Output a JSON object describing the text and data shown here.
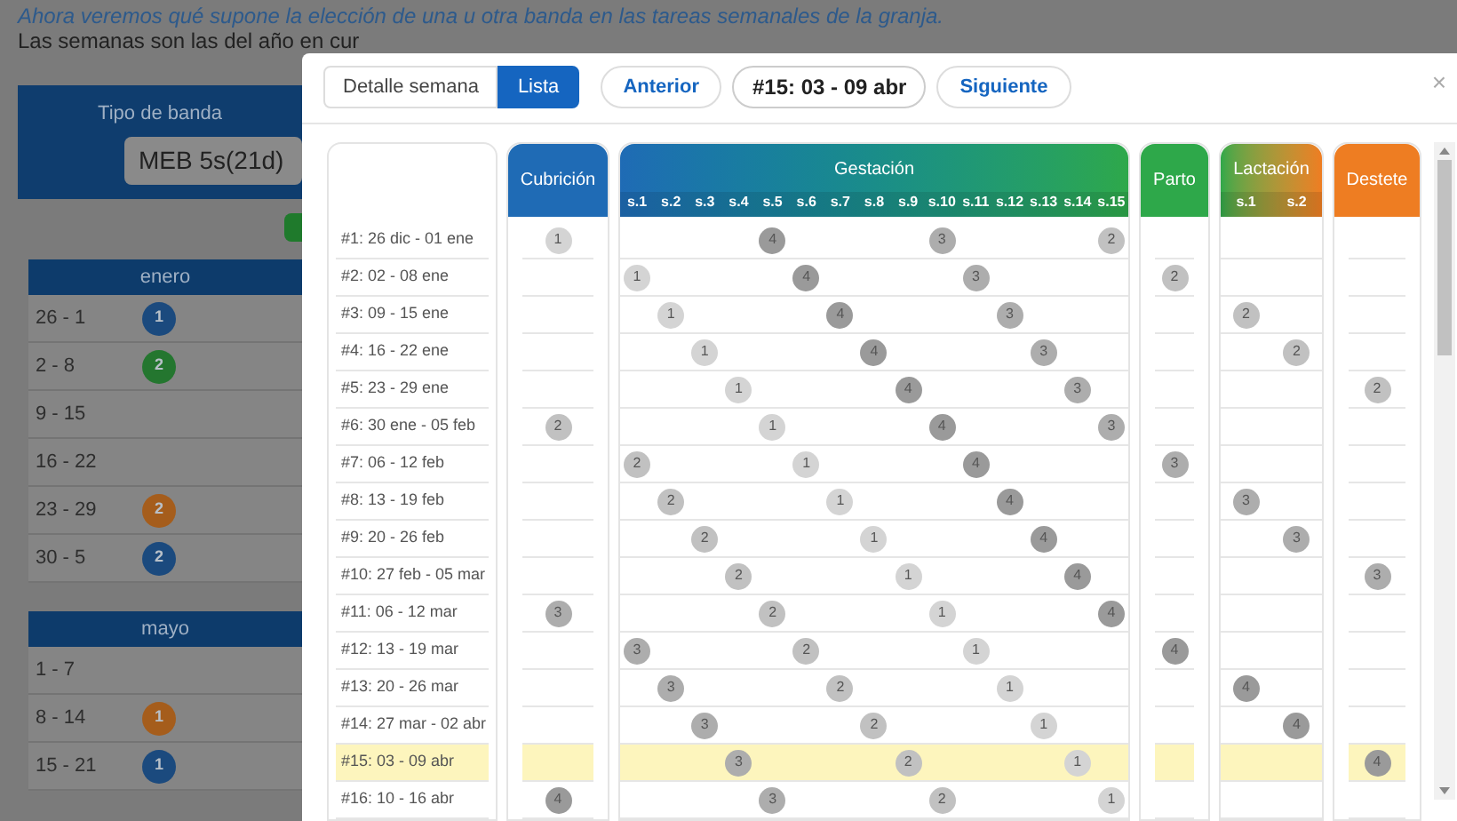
{
  "page": {
    "intro": "Ahora veremos qué supone la elección de una u otra banda en las tareas semanales de la granja.",
    "note": "Las semanas son las del año en cur",
    "band_panel": {
      "label": "Tipo de banda",
      "value": "MEB 5s(21d)"
    },
    "months": [
      {
        "name": "enero",
        "weeks": [
          {
            "range": "26 - 1",
            "badge": {
              "text": "1",
              "color": "#1b4a7e"
            }
          },
          {
            "range": "2 - 8",
            "badge": {
              "text": "2",
              "color": "#24762f"
            }
          },
          {
            "range": "9 - 15"
          },
          {
            "range": "16 - 22"
          },
          {
            "range": "23 - 29",
            "badge": {
              "text": "2",
              "color": "#a55d1c"
            }
          },
          {
            "range": "30 - 5",
            "badge": {
              "text": "2",
              "color": "#1b4a7e"
            }
          }
        ]
      },
      {
        "name": "mayo",
        "weeks": [
          {
            "range": "1 - 7"
          },
          {
            "range": "8 - 14",
            "badge": {
              "text": "1",
              "color": "#a55d1c"
            }
          },
          {
            "range": "15 - 21",
            "badge": {
              "text": "1",
              "color": "#1b4a7e"
            }
          }
        ]
      }
    ]
  },
  "dialog": {
    "view_tabs": [
      {
        "label": "Detalle semana",
        "selected": false
      },
      {
        "label": "Lista",
        "selected": true
      }
    ],
    "previous": "Anterior",
    "current": "#15: 03 - 09 abr",
    "next": "Siguiente",
    "close": "×",
    "columns": {
      "cubricion": "Cubrición",
      "gestacion": {
        "title": "Gestación",
        "weeks": [
          "s.1",
          "s.2",
          "s.3",
          "s.4",
          "s.5",
          "s.6",
          "s.7",
          "s.8",
          "s.9",
          "s.10",
          "s.11",
          "s.12",
          "s.13",
          "s.14",
          "s.15"
        ]
      },
      "parto": "Parto",
      "lactacion": {
        "title": "Lactación",
        "weeks": [
          "s.1",
          "s.2"
        ]
      },
      "destete": "Destete"
    },
    "rows": [
      {
        "label": "#1: 26 dic - 01 ene",
        "selected": false,
        "cubricion": {
          "band": "1",
          "color": "#d4d4d4"
        },
        "gestacion": [
          {
            "kind": "empty"
          },
          {
            "kind": "empty"
          },
          {
            "kind": "empty"
          },
          {
            "kind": "empty"
          },
          {
            "kind": "marker",
            "band": "4",
            "color": "#9a9a9a"
          },
          {
            "kind": "empty"
          },
          {
            "kind": "empty"
          },
          {
            "kind": "empty"
          },
          {
            "kind": "empty"
          },
          {
            "kind": "marker",
            "band": "3",
            "color": "#adadad"
          },
          {
            "kind": "empty"
          },
          {
            "kind": "empty"
          },
          {
            "kind": "empty"
          },
          {
            "kind": "empty"
          },
          {
            "kind": "marker",
            "band": "2",
            "color": "#c1c1c1"
          }
        ]
      },
      {
        "label": "#2: 02 - 08 ene",
        "selected": false,
        "gestacion": [
          {
            "kind": "marker",
            "band": "1",
            "color": "#d4d4d4"
          },
          {
            "kind": "empty"
          },
          {
            "kind": "empty"
          },
          {
            "kind": "empty"
          },
          {
            "kind": "empty"
          },
          {
            "kind": "marker",
            "band": "4",
            "color": "#9a9a9a"
          },
          {
            "kind": "empty"
          },
          {
            "kind": "empty"
          },
          {
            "kind": "empty"
          },
          {
            "kind": "empty"
          },
          {
            "kind": "marker",
            "band": "3",
            "color": "#adadad"
          },
          {
            "kind": "empty"
          },
          {
            "kind": "empty"
          },
          {
            "kind": "empty"
          },
          {
            "kind": "empty"
          }
        ],
        "parto": {
          "band": "2",
          "color": "#c1c1c1"
        }
      },
      {
        "label": "#3: 09 - 15 ene",
        "selected": false,
        "gestacion": [
          {
            "kind": "empty"
          },
          {
            "kind": "marker",
            "band": "1",
            "color": "#d4d4d4"
          },
          {
            "kind": "empty"
          },
          {
            "kind": "empty"
          },
          {
            "kind": "empty"
          },
          {
            "kind": "empty"
          },
          {
            "kind": "marker",
            "band": "4",
            "color": "#9a9a9a"
          },
          {
            "kind": "empty"
          },
          {
            "kind": "empty"
          },
          {
            "kind": "empty"
          },
          {
            "kind": "empty"
          },
          {
            "kind": "marker",
            "band": "3",
            "color": "#adadad"
          },
          {
            "kind": "empty"
          },
          {
            "kind": "empty"
          },
          {
            "kind": "empty"
          }
        ],
        "lactacion": [
          {
            "kind": "marker",
            "band": "2",
            "color": "#c1c1c1"
          },
          {
            "kind": "empty"
          }
        ]
      },
      {
        "label": "#4: 16 - 22 ene",
        "selected": false,
        "gestacion": [
          {
            "kind": "empty"
          },
          {
            "kind": "empty"
          },
          {
            "kind": "marker",
            "band": "1",
            "color": "#d4d4d4"
          },
          {
            "kind": "empty"
          },
          {
            "kind": "empty"
          },
          {
            "kind": "empty"
          },
          {
            "kind": "empty"
          },
          {
            "kind": "marker",
            "band": "4",
            "color": "#9a9a9a"
          },
          {
            "kind": "empty"
          },
          {
            "kind": "empty"
          },
          {
            "kind": "empty"
          },
          {
            "kind": "empty"
          },
          {
            "kind": "marker",
            "band": "3",
            "color": "#adadad"
          },
          {
            "kind": "empty"
          },
          {
            "kind": "empty"
          }
        ],
        "lactacion": [
          {
            "kind": "empty"
          },
          {
            "kind": "marker",
            "band": "2",
            "color": "#c1c1c1"
          }
        ]
      },
      {
        "label": "#5: 23 - 29 ene",
        "selected": false,
        "gestacion": [
          {
            "kind": "empty"
          },
          {
            "kind": "empty"
          },
          {
            "kind": "empty"
          },
          {
            "kind": "marker",
            "band": "1",
            "color": "#d4d4d4"
          },
          {
            "kind": "empty"
          },
          {
            "kind": "empty"
          },
          {
            "kind": "empty"
          },
          {
            "kind": "empty"
          },
          {
            "kind": "marker",
            "band": "4",
            "color": "#9a9a9a"
          },
          {
            "kind": "empty"
          },
          {
            "kind": "empty"
          },
          {
            "kind": "empty"
          },
          {
            "kind": "empty"
          },
          {
            "kind": "marker",
            "band": "3",
            "color": "#adadad"
          },
          {
            "kind": "empty"
          }
        ],
        "destete": {
          "band": "2",
          "color": "#c1c1c1"
        }
      },
      {
        "label": "#6: 30 ene - 05 feb",
        "selected": false,
        "cubricion": {
          "band": "2",
          "color": "#c1c1c1"
        },
        "gestacion": [
          {
            "kind": "empty"
          },
          {
            "kind": "empty"
          },
          {
            "kind": "empty"
          },
          {
            "kind": "empty"
          },
          {
            "kind": "marker",
            "band": "1",
            "color": "#d4d4d4"
          },
          {
            "kind": "empty"
          },
          {
            "kind": "empty"
          },
          {
            "kind": "empty"
          },
          {
            "kind": "empty"
          },
          {
            "kind": "marker",
            "band": "4",
            "color": "#9a9a9a"
          },
          {
            "kind": "empty"
          },
          {
            "kind": "empty"
          },
          {
            "kind": "empty"
          },
          {
            "kind": "empty"
          },
          {
            "kind": "marker",
            "band": "3",
            "color": "#adadad"
          }
        ]
      },
      {
        "label": "#7: 06 - 12 feb",
        "selected": false,
        "gestacion": [
          {
            "kind": "marker",
            "band": "2",
            "color": "#c1c1c1"
          },
          {
            "kind": "empty"
          },
          {
            "kind": "empty"
          },
          {
            "kind": "empty"
          },
          {
            "kind": "empty"
          },
          {
            "kind": "marker",
            "band": "1",
            "color": "#d4d4d4"
          },
          {
            "kind": "empty"
          },
          {
            "kind": "empty"
          },
          {
            "kind": "empty"
          },
          {
            "kind": "empty"
          },
          {
            "kind": "marker",
            "band": "4",
            "color": "#9a9a9a"
          },
          {
            "kind": "empty"
          },
          {
            "kind": "empty"
          },
          {
            "kind": "empty"
          },
          {
            "kind": "empty"
          }
        ],
        "parto": {
          "band": "3",
          "color": "#adadad"
        }
      },
      {
        "label": "#8: 13 - 19 feb",
        "selected": false,
        "gestacion": [
          {
            "kind": "empty"
          },
          {
            "kind": "marker",
            "band": "2",
            "color": "#c1c1c1"
          },
          {
            "kind": "empty"
          },
          {
            "kind": "empty"
          },
          {
            "kind": "empty"
          },
          {
            "kind": "empty"
          },
          {
            "kind": "marker",
            "band": "1",
            "color": "#d4d4d4"
          },
          {
            "kind": "empty"
          },
          {
            "kind": "empty"
          },
          {
            "kind": "empty"
          },
          {
            "kind": "empty"
          },
          {
            "kind": "marker",
            "band": "4",
            "color": "#9a9a9a"
          },
          {
            "kind": "empty"
          },
          {
            "kind": "empty"
          },
          {
            "kind": "empty"
          }
        ],
        "lactacion": [
          {
            "kind": "marker",
            "band": "3",
            "color": "#adadad"
          },
          {
            "kind": "empty"
          }
        ]
      },
      {
        "label": "#9: 20 - 26 feb",
        "selected": false,
        "gestacion": [
          {
            "kind": "empty"
          },
          {
            "kind": "empty"
          },
          {
            "kind": "marker",
            "band": "2",
            "color": "#c1c1c1"
          },
          {
            "kind": "empty"
          },
          {
            "kind": "empty"
          },
          {
            "kind": "empty"
          },
          {
            "kind": "empty"
          },
          {
            "kind": "marker",
            "band": "1",
            "color": "#d4d4d4"
          },
          {
            "kind": "empty"
          },
          {
            "kind": "empty"
          },
          {
            "kind": "empty"
          },
          {
            "kind": "empty"
          },
          {
            "kind": "marker",
            "band": "4",
            "color": "#9a9a9a"
          },
          {
            "kind": "empty"
          },
          {
            "kind": "empty"
          }
        ],
        "lactacion": [
          {
            "kind": "empty"
          },
          {
            "kind": "marker",
            "band": "3",
            "color": "#adadad"
          }
        ]
      },
      {
        "label": "#10: 27 feb - 05 mar",
        "selected": false,
        "gestacion": [
          {
            "kind": "empty"
          },
          {
            "kind": "empty"
          },
          {
            "kind": "empty"
          },
          {
            "kind": "marker",
            "band": "2",
            "color": "#c1c1c1"
          },
          {
            "kind": "empty"
          },
          {
            "kind": "empty"
          },
          {
            "kind": "empty"
          },
          {
            "kind": "empty"
          },
          {
            "kind": "marker",
            "band": "1",
            "color": "#d4d4d4"
          },
          {
            "kind": "empty"
          },
          {
            "kind": "empty"
          },
          {
            "kind": "empty"
          },
          {
            "kind": "empty"
          },
          {
            "kind": "marker",
            "band": "4",
            "color": "#9a9a9a"
          },
          {
            "kind": "empty"
          }
        ],
        "destete": {
          "band": "3",
          "color": "#adadad"
        }
      },
      {
        "label": "#11: 06 - 12 mar",
        "selected": false,
        "cubricion": {
          "band": "3",
          "color": "#adadad"
        },
        "gestacion": [
          {
            "kind": "empty"
          },
          {
            "kind": "empty"
          },
          {
            "kind": "empty"
          },
          {
            "kind": "empty"
          },
          {
            "kind": "marker",
            "band": "2",
            "color": "#c1c1c1"
          },
          {
            "kind": "empty"
          },
          {
            "kind": "empty"
          },
          {
            "kind": "empty"
          },
          {
            "kind": "empty"
          },
          {
            "kind": "marker",
            "band": "1",
            "color": "#d4d4d4"
          },
          {
            "kind": "empty"
          },
          {
            "kind": "empty"
          },
          {
            "kind": "empty"
          },
          {
            "kind": "empty"
          },
          {
            "kind": "marker",
            "band": "4",
            "color": "#9a9a9a"
          }
        ]
      },
      {
        "label": "#12: 13 - 19 mar",
        "selected": false,
        "gestacion": [
          {
            "kind": "marker",
            "band": "3",
            "color": "#adadad"
          },
          {
            "kind": "empty"
          },
          {
            "kind": "empty"
          },
          {
            "kind": "empty"
          },
          {
            "kind": "empty"
          },
          {
            "kind": "marker",
            "band": "2",
            "color": "#c1c1c1"
          },
          {
            "kind": "empty"
          },
          {
            "kind": "empty"
          },
          {
            "kind": "empty"
          },
          {
            "kind": "empty"
          },
          {
            "kind": "marker",
            "band": "1",
            "color": "#d4d4d4"
          },
          {
            "kind": "empty"
          },
          {
            "kind": "empty"
          },
          {
            "kind": "empty"
          },
          {
            "kind": "empty"
          }
        ],
        "parto": {
          "band": "4",
          "color": "#9a9a9a"
        }
      },
      {
        "label": "#13: 20 - 26 mar",
        "selected": false,
        "gestacion": [
          {
            "kind": "empty"
          },
          {
            "kind": "marker",
            "band": "3",
            "color": "#adadad"
          },
          {
            "kind": "empty"
          },
          {
            "kind": "empty"
          },
          {
            "kind": "empty"
          },
          {
            "kind": "empty"
          },
          {
            "kind": "marker",
            "band": "2",
            "color": "#c1c1c1"
          },
          {
            "kind": "empty"
          },
          {
            "kind": "empty"
          },
          {
            "kind": "empty"
          },
          {
            "kind": "empty"
          },
          {
            "kind": "marker",
            "band": "1",
            "color": "#d4d4d4"
          },
          {
            "kind": "empty"
          },
          {
            "kind": "empty"
          },
          {
            "kind": "empty"
          }
        ],
        "lactacion": [
          {
            "kind": "marker",
            "band": "4",
            "color": "#9a9a9a"
          },
          {
            "kind": "empty"
          }
        ]
      },
      {
        "label": "#14: 27 mar - 02 abr",
        "selected": false,
        "gestacion": [
          {
            "kind": "empty"
          },
          {
            "kind": "empty"
          },
          {
            "kind": "marker",
            "band": "3",
            "color": "#adadad"
          },
          {
            "kind": "empty"
          },
          {
            "kind": "empty"
          },
          {
            "kind": "empty"
          },
          {
            "kind": "empty"
          },
          {
            "kind": "marker",
            "band": "2",
            "color": "#c1c1c1"
          },
          {
            "kind": "empty"
          },
          {
            "kind": "empty"
          },
          {
            "kind": "empty"
          },
          {
            "kind": "empty"
          },
          {
            "kind": "marker",
            "band": "1",
            "color": "#d4d4d4"
          },
          {
            "kind": "empty"
          },
          {
            "kind": "empty"
          }
        ],
        "lactacion": [
          {
            "kind": "empty"
          },
          {
            "kind": "marker",
            "band": "4",
            "color": "#9a9a9a"
          }
        ]
      },
      {
        "label": "#15: 03 - 09 abr",
        "selected": true,
        "gestacion": [
          {
            "kind": "empty"
          },
          {
            "kind": "empty"
          },
          {
            "kind": "empty"
          },
          {
            "kind": "marker",
            "band": "3",
            "color": "#adadad"
          },
          {
            "kind": "empty"
          },
          {
            "kind": "empty"
          },
          {
            "kind": "empty"
          },
          {
            "kind": "empty"
          },
          {
            "kind": "marker",
            "band": "2",
            "color": "#c1c1c1"
          },
          {
            "kind": "empty"
          },
          {
            "kind": "empty"
          },
          {
            "kind": "empty"
          },
          {
            "kind": "empty"
          },
          {
            "kind": "marker",
            "band": "1",
            "color": "#d4d4d4"
          },
          {
            "kind": "empty"
          }
        ],
        "destete": {
          "band": "4",
          "color": "#9a9a9a"
        }
      },
      {
        "label": "#16: 10 - 16 abr",
        "selected": false,
        "cubricion": {
          "band": "4",
          "color": "#9a9a9a"
        },
        "gestacion": [
          {
            "kind": "empty"
          },
          {
            "kind": "empty"
          },
          {
            "kind": "empty"
          },
          {
            "kind": "empty"
          },
          {
            "kind": "marker",
            "band": "3",
            "color": "#adadad"
          },
          {
            "kind": "empty"
          },
          {
            "kind": "empty"
          },
          {
            "kind": "empty"
          },
          {
            "kind": "empty"
          },
          {
            "kind": "marker",
            "band": "2",
            "color": "#c1c1c1"
          },
          {
            "kind": "empty"
          },
          {
            "kind": "empty"
          },
          {
            "kind": "empty"
          },
          {
            "kind": "empty"
          },
          {
            "kind": "marker",
            "band": "1",
            "color": "#d4d4d4"
          }
        ]
      }
    ]
  }
}
